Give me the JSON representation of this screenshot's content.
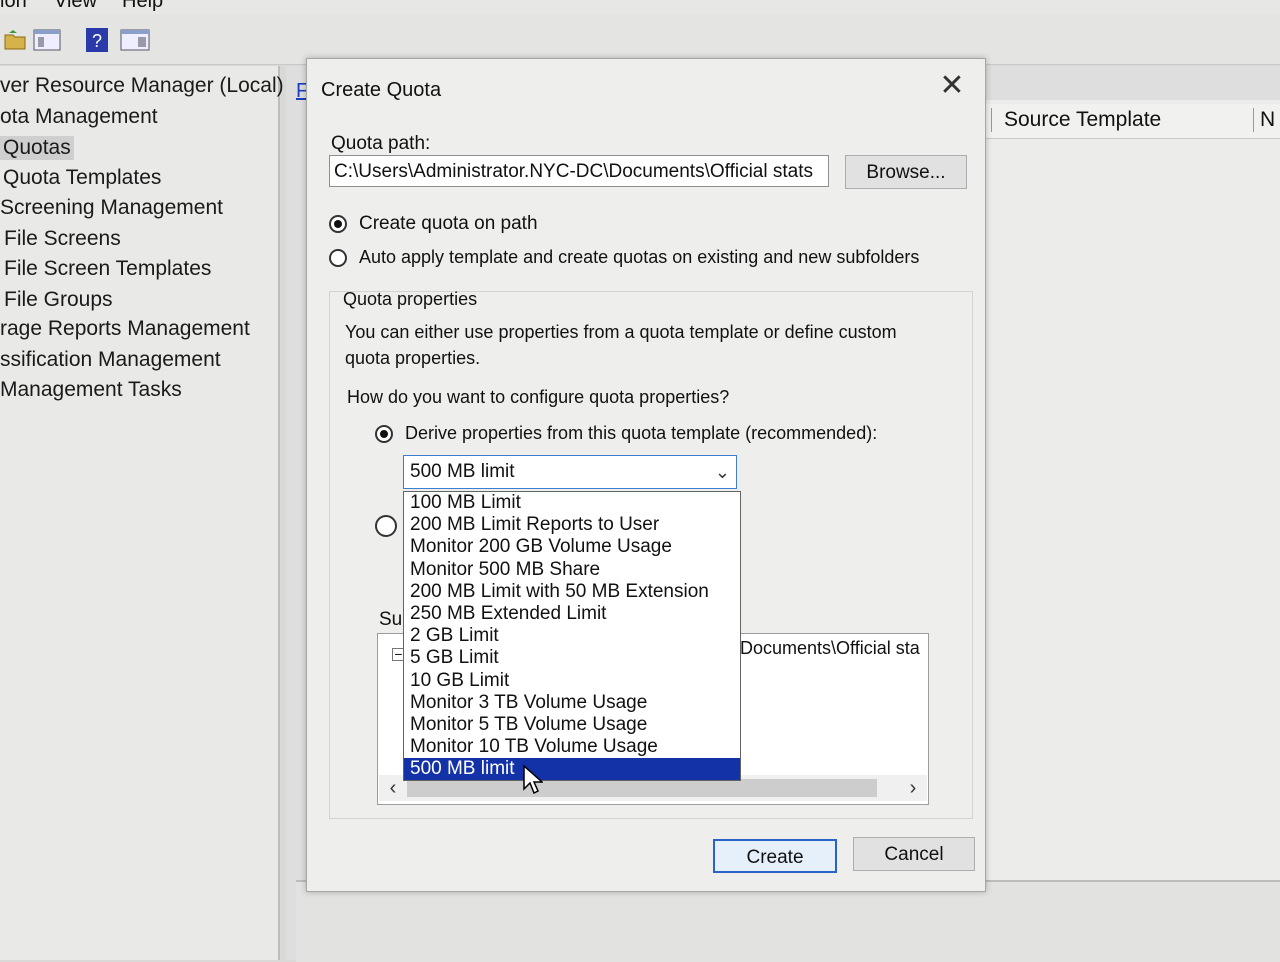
{
  "menu": {
    "items": [
      "ion",
      "View",
      "Help"
    ]
  },
  "tree": {
    "items": [
      {
        "label": "ver Resource Manager (Local)",
        "selected": false
      },
      {
        "label": "ota Management",
        "selected": false
      },
      {
        "label": "Quotas",
        "selected": true
      },
      {
        "label": "Quota Templates",
        "selected": false
      },
      {
        "label": "Screening Management",
        "selected": false
      },
      {
        "label": "File Screens",
        "selected": false
      },
      {
        "label": "File Screen Templates",
        "selected": false
      },
      {
        "label": "File Groups",
        "selected": false
      },
      {
        "label": "rage Reports Management",
        "selected": false
      },
      {
        "label": "ssification Management",
        "selected": false
      },
      {
        "label": "Management Tasks",
        "selected": false
      }
    ]
  },
  "background": {
    "column_header": "Source Template",
    "link_char": "F"
  },
  "dialog": {
    "title": "Create Quota",
    "quota_path_label": "Quota path:",
    "quota_path_value": "C:\\Users\\Administrator.NYC-DC\\Documents\\Official stats",
    "browse_label": "Browse...",
    "radio_create": "Create quota on path",
    "radio_auto": "Auto apply template and create quotas on existing and new subfolders",
    "group_label": "Quota properties",
    "description": "You can either use properties from a quota template or define custom quota properties.",
    "question": "How do you want to configure quota properties?",
    "radio_derive": "Derive properties from this quota template (recommended):",
    "combo_value": "500 MB limit",
    "summary_label": "Sur",
    "summary_text": "Documents\\Official sta",
    "create_label": "Create",
    "cancel_label": "Cancel"
  },
  "dropdown": {
    "options": [
      "100 MB Limit",
      "200 MB Limit Reports to User",
      "Monitor 200 GB Volume Usage",
      "Monitor 500 MB Share",
      "200 MB Limit with 50 MB Extension",
      "250 MB Extended Limit",
      "2 GB Limit",
      "5 GB Limit",
      "10 GB Limit",
      "Monitor 3 TB Volume Usage",
      "Monitor 5 TB Volume Usage",
      "Monitor 10 TB Volume Usage",
      "500 MB limit"
    ],
    "selected_index": 12
  },
  "colors": {
    "selection": "#1432a8",
    "focus_border": "#2a63c8"
  }
}
